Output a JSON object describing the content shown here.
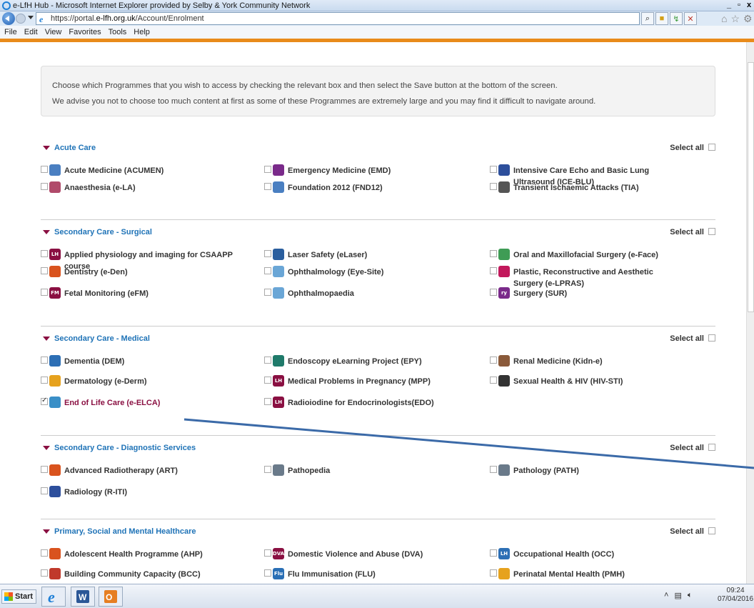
{
  "window": {
    "title": "e-LfH Hub - Microsoft Internet Explorer provided by Selby & York Community Network"
  },
  "address": {
    "url_prefix": "https://portal.",
    "url_domain": "e-lfh.org.uk",
    "url_path": "/Account/Enrolment"
  },
  "menu": [
    "File",
    "Edit",
    "View",
    "Favorites",
    "Tools",
    "Help"
  ],
  "info": {
    "line1": "Choose which Programmes that you wish to access by checking the relevant box and then select the Save button at the bottom of the screen.",
    "line2": "We advise you not to choose too much content at first as some of these Programmes are extremely large and you may find it difficult to navigate around."
  },
  "select_all_label": "Select all",
  "sections": [
    {
      "title": "Acute Care",
      "items": [
        {
          "label": "Acute Medicine (ACUMEN)",
          "icon_text": "",
          "color": "#4a7fc1"
        },
        {
          "label": "Emergency Medicine (EMD)",
          "icon_text": "",
          "color": "#7a2a8a"
        },
        {
          "label": "Intensive Care Echo and Basic Lung Ultrasound (ICE-BLU)",
          "icon_text": "",
          "color": "#2d4f9c"
        },
        {
          "label": "Anaesthesia (e-LA)",
          "icon_text": "",
          "color": "#b04a6a"
        },
        {
          "label": "Foundation 2012 (FND12)",
          "icon_text": "",
          "color": "#4a7fc1"
        },
        {
          "label": "Transient Ischaemic Attacks (TIA)",
          "icon_text": "",
          "color": "#555"
        }
      ]
    },
    {
      "title": "Secondary Care - Surgical",
      "items": [
        {
          "label": "Applied physiology and imaging for CSAAPP course",
          "icon_text": "LH",
          "color": "#8a1042"
        },
        {
          "label": "Laser Safety (eLaser)",
          "icon_text": "",
          "color": "#2a5e9e"
        },
        {
          "label": "Oral and Maxillofacial Surgery (e-Face)",
          "icon_text": "",
          "color": "#3f9c55"
        },
        {
          "label": "Dentistry (e-Den)",
          "icon_text": "",
          "color": "#d9531e"
        },
        {
          "label": "Ophthalmology (Eye-Site)",
          "icon_text": "",
          "color": "#6aa6d6"
        },
        {
          "label": "Plastic, Reconstructive and Aesthetic Surgery (e-LPRAS)",
          "icon_text": "",
          "color": "#c2185b"
        },
        {
          "label": "Fetal Monitoring (eFM)",
          "icon_text": "FM",
          "color": "#8a1042"
        },
        {
          "label": "Ophthalmopaedia",
          "icon_text": "",
          "color": "#6aa6d6"
        },
        {
          "label": "Surgery (SUR)",
          "icon_text": "ry",
          "color": "#7a2a8a"
        }
      ]
    },
    {
      "title": "Secondary Care - Medical",
      "items": [
        {
          "label": "Dementia (DEM)",
          "icon_text": "",
          "color": "#2d6fb5"
        },
        {
          "label": "Endoscopy eLearning Project (EPY)",
          "icon_text": "",
          "color": "#1f7a6a"
        },
        {
          "label": "Renal Medicine (Kidn-e)",
          "icon_text": "",
          "color": "#8a5a3a"
        },
        {
          "label": "Dermatology (e-Derm)",
          "icon_text": "",
          "color": "#e6a21e"
        },
        {
          "label": "Medical Problems in Pregnancy (MPP)",
          "icon_text": "LH",
          "color": "#8a1042"
        },
        {
          "label": "Sexual Health & HIV (HIV-STI)",
          "icon_text": "",
          "color": "#333"
        },
        {
          "label": "End of Life Care (e-ELCA)",
          "icon_text": "",
          "color": "#3a8fc7",
          "checked": true
        },
        {
          "label": "Radioiodine for Endocrinologists(EDO)",
          "icon_text": "LH",
          "color": "#8a1042"
        }
      ]
    },
    {
      "title": "Secondary Care - Diagnostic Services",
      "items": [
        {
          "label": "Advanced Radiotherapy (ART)",
          "icon_text": "",
          "color": "#d9531e"
        },
        {
          "label": "Pathopedia",
          "icon_text": "",
          "color": "#6a7a8a"
        },
        {
          "label": "Pathology (PATH)",
          "icon_text": "",
          "color": "#6a7a8a"
        },
        {
          "label": "Radiology (R-ITI)",
          "icon_text": "",
          "color": "#2d4f9c"
        }
      ]
    },
    {
      "title": "Primary, Social and Mental Healthcare",
      "items": [
        {
          "label": "Adolescent Health Programme (AHP)",
          "icon_text": "",
          "color": "#d9531e"
        },
        {
          "label": "Domestic Violence and Abuse (DVA)",
          "icon_text": "DVA",
          "color": "#8a1042"
        },
        {
          "label": "Occupational Health (OCC)",
          "icon_text": "LH",
          "color": "#2d6fb5"
        },
        {
          "label": "Building Community Capacity (BCC)",
          "icon_text": "",
          "color": "#c0392b"
        },
        {
          "label": "Flu Immunisation (FLU)",
          "icon_text": "Flu",
          "color": "#2a6fb5"
        },
        {
          "label": "Perinatal Mental Health (PMH)",
          "icon_text": "",
          "color": "#e6a21e"
        }
      ]
    }
  ],
  "taskbar": {
    "start": "Start",
    "time": "09:24",
    "date": "07/04/2016"
  }
}
